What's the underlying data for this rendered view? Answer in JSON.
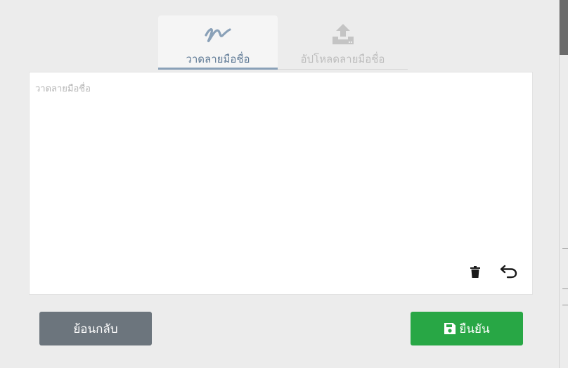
{
  "tabs": {
    "draw": {
      "label": "วาดลายมือชื่อ",
      "icon": "signature-icon",
      "active": true
    },
    "upload": {
      "label": "อัปโหลดลายมือชื่อ",
      "icon": "upload-icon",
      "active": false
    }
  },
  "pad": {
    "placeholder": "วาดลายมือชื่อ",
    "clear_icon": "trash-icon",
    "undo_icon": "undo-icon"
  },
  "footer": {
    "back_label": "ย้อนกลับ",
    "confirm_label": "ยืนยัน",
    "confirm_icon": "save-icon"
  },
  "colors": {
    "active_tab": "#5f7a96",
    "back_button": "#6c757d",
    "confirm_button": "#28a745"
  }
}
